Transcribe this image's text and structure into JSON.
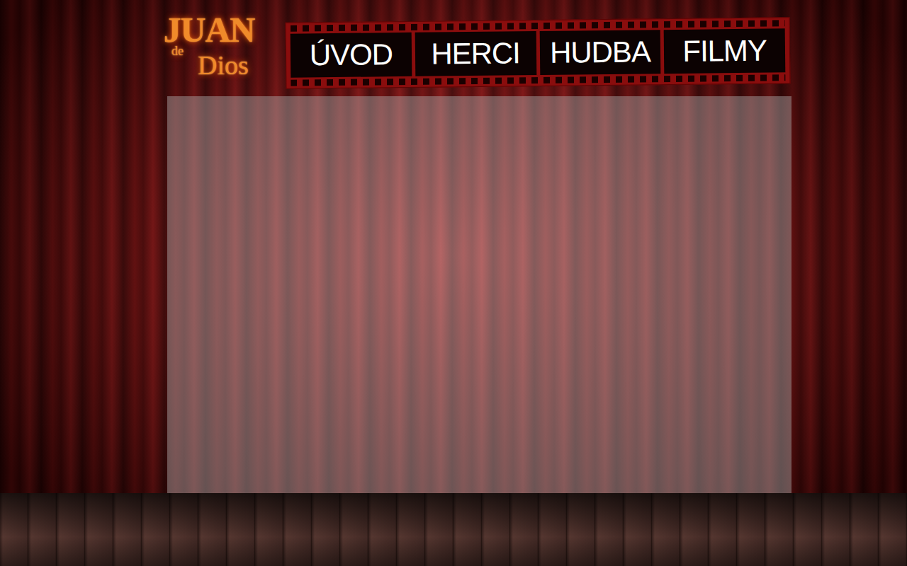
{
  "logo": {
    "lines": [
      "JUAN",
      "de",
      "Dios"
    ]
  },
  "nav": [
    {
      "label": "ÚVOD"
    },
    {
      "label": "HERCI"
    },
    {
      "label": "HUDBA"
    },
    {
      "label": "FILMY"
    }
  ],
  "content_panel": {
    "empty": true
  }
}
